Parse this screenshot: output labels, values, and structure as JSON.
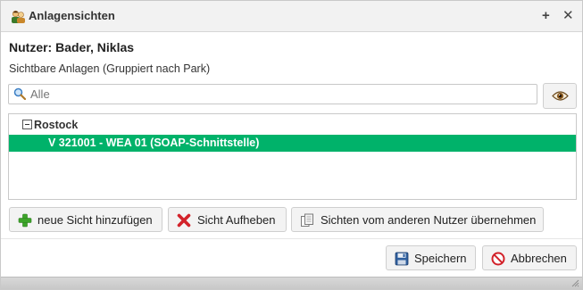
{
  "window": {
    "title": "Anlagensichten",
    "icons": {
      "title": "users-icon",
      "plus": "plus-icon",
      "close": "close-icon"
    },
    "tools": {
      "plus": "+",
      "close": "✕"
    }
  },
  "header": {
    "user_line": "Nutzer: Bader, Niklas",
    "subtitle": "Sichtbare Anlagen (Gruppiert nach Park)"
  },
  "search": {
    "value": "",
    "placeholder": "Alle",
    "icon": "search-icon",
    "toggle_icon": "eye-icon"
  },
  "tree": {
    "groups": [
      {
        "label": "Rostock",
        "expanded": true,
        "items": [
          {
            "label": "V 321001 - WEA 01 (SOAP-Schnittstelle)",
            "selected": true
          }
        ]
      }
    ],
    "selected_color": "#00b26a"
  },
  "actions": {
    "add_label": "neue Sicht hinzufügen",
    "remove_label": "Sicht Aufheben",
    "copy_label": "Sichten vom anderen Nutzer übernehmen"
  },
  "footer": {
    "save_label": "Speichern",
    "cancel_label": "Abbrechen"
  }
}
